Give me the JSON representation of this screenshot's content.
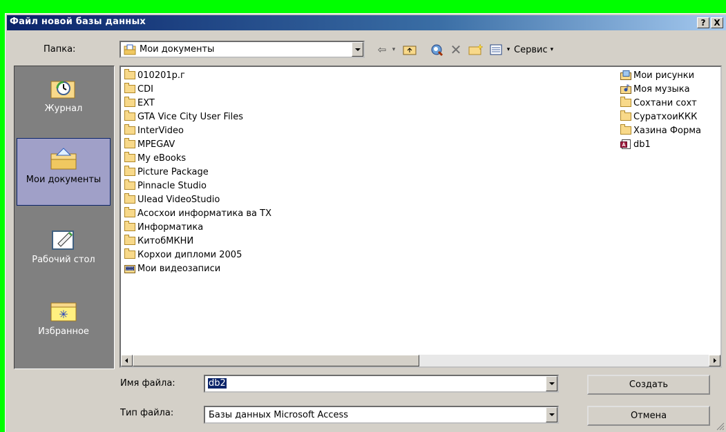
{
  "title": "Файл новой базы данных",
  "title_buttons": {
    "help": "?",
    "close": "X"
  },
  "folder_label": "Папка:",
  "folder_value": "Мои документы",
  "tools_label": "Сервис",
  "places": [
    {
      "name": "place-history",
      "label": "Журнал"
    },
    {
      "name": "place-my-documents",
      "label": "Мои документы"
    },
    {
      "name": "place-desktop",
      "label": "Рабочий стол"
    },
    {
      "name": "place-favorites",
      "label": "Избранное"
    }
  ],
  "files_col1": [
    "010201р.г",
    "CDI",
    "EXT",
    "GTA Vice City User Files",
    "InterVideo",
    "MPEGAV",
    "My eBooks",
    "Picture Package",
    "Pinnacle Studio",
    "Ulead VideoStudio",
    "Асосхои информатика ва ТХ",
    "Информатика",
    "КитобМКНИ",
    "Корхои дипломи 2005",
    "Мои видеозаписи"
  ],
  "files_col2": [
    "Мои рисунки",
    "Моя музыка",
    "Сохтани сохт",
    "СуратхоиККК",
    "Хазина Форма",
    "db1"
  ],
  "filename_label": "Имя файла:",
  "filename_value": "db2",
  "filetype_label": "Тип файла:",
  "filetype_value": "Базы данных Microsoft Access",
  "create_button": "Создать",
  "cancel_button": "Отмена"
}
